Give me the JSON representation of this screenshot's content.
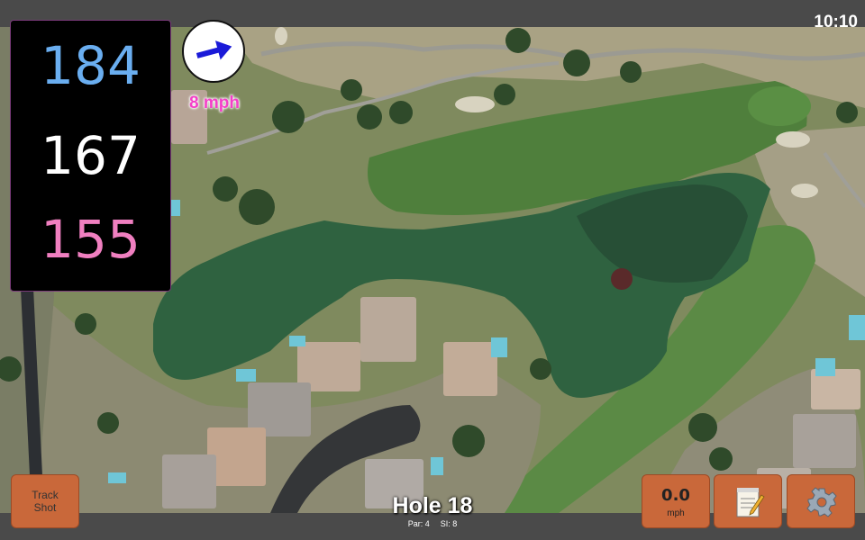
{
  "status": {
    "time": "10:10"
  },
  "distances": {
    "back": "184",
    "middle": "167",
    "front": "155"
  },
  "wind": {
    "speed": "8 mph",
    "icon": "arrow-icon"
  },
  "buttons": {
    "track_shot": "Track\nShot",
    "speed_value": "0.0",
    "speed_unit": "mph",
    "notes_icon": "notepad-icon",
    "settings_icon": "gear-icon"
  },
  "hole": {
    "title": "Hole 18",
    "par": "Par: 4",
    "si": "SI: 8"
  },
  "colors": {
    "back": "#6aaef0",
    "middle": "#ffffff",
    "front": "#f07fc0",
    "button": "#c9683a",
    "wind_text": "#f43fc8"
  }
}
